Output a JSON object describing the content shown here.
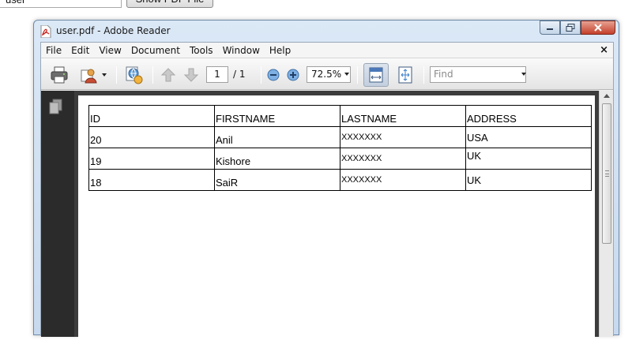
{
  "outer": {
    "input_value": "user",
    "button_label": "Show PDF File"
  },
  "window": {
    "title": "user.pdf - Adobe Reader",
    "controls": [
      "minimize",
      "maximize",
      "close"
    ]
  },
  "menu": {
    "items": [
      "File",
      "Edit",
      "View",
      "Document",
      "Tools",
      "Window",
      "Help"
    ],
    "close_glyph": "×"
  },
  "toolbar": {
    "page_current": "1",
    "page_total": "/ 1",
    "zoom": "72.5%",
    "find_placeholder": "Find"
  },
  "table": {
    "headers": [
      "ID",
      "FIRSTNAME",
      "LASTNAME",
      "ADDRESS"
    ],
    "rows": [
      [
        "20",
        "Anil",
        "XXXXXXX",
        "USA"
      ],
      [
        "19",
        "Kishore",
        "XXXXXXX",
        "UK"
      ],
      [
        "18",
        "SaiR",
        "XXXXXXX",
        "UK"
      ]
    ]
  },
  "colors": {
    "title_gradient_top": "#dbe8f6",
    "close_button": "#c4402a",
    "left_panel": "#2b2b2b",
    "doc_background": "#3c3c3c"
  },
  "icons": [
    "pdf-file-icon",
    "print-icon",
    "user-icon",
    "collaborate-icon",
    "arrow-up-icon",
    "arrow-down-icon",
    "zoom-out-icon",
    "zoom-in-icon",
    "fit-width-icon",
    "fit-page-icon",
    "pages-panel-icon"
  ]
}
